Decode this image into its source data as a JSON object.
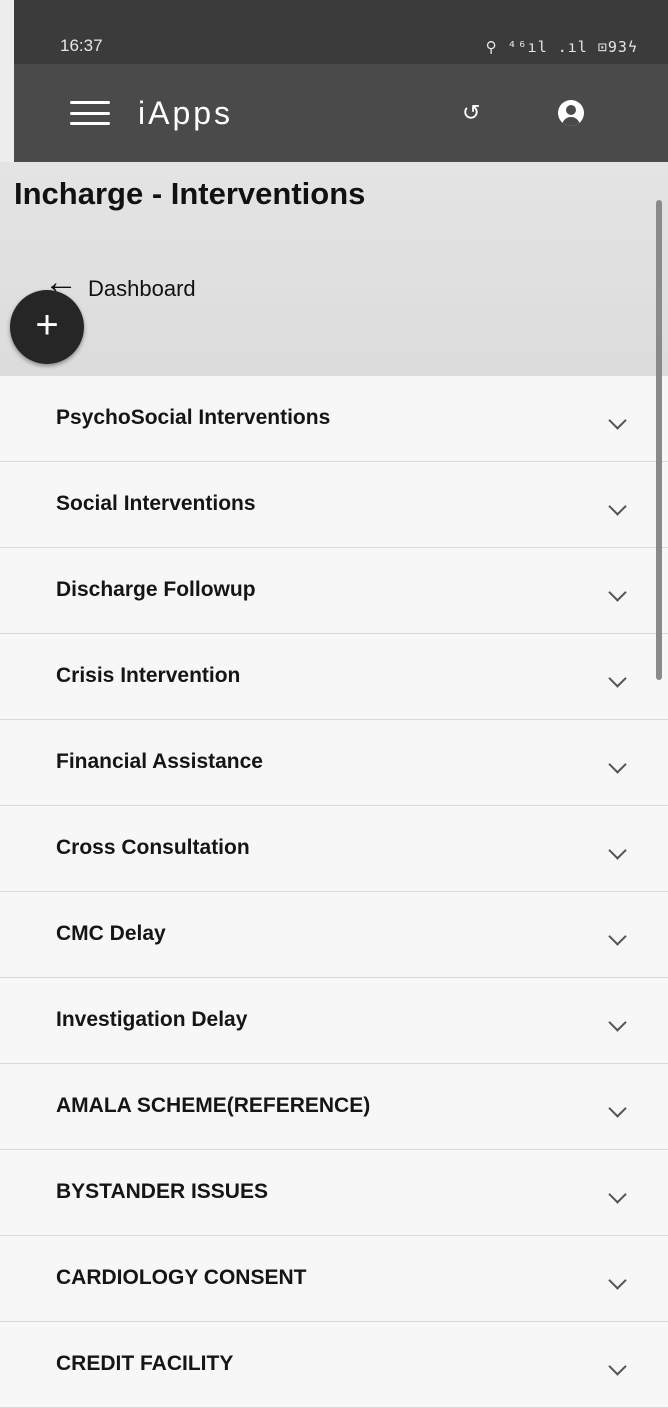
{
  "status_bar": {
    "time": "16:37",
    "indicators": "⚲ ⁴⁶ıl .ıl ⊡93ϟ"
  },
  "app_bar": {
    "title": "iApps"
  },
  "page": {
    "title": "Incharge - Interventions",
    "back_label": "Dashboard",
    "fab_symbol": "+"
  },
  "list": {
    "items": [
      {
        "label": "PsychoSocial Interventions"
      },
      {
        "label": "Social Interventions"
      },
      {
        "label": "Discharge Followup"
      },
      {
        "label": "Crisis Intervention"
      },
      {
        "label": "Financial Assistance"
      },
      {
        "label": "Cross Consultation"
      },
      {
        "label": "CMC Delay"
      },
      {
        "label": "Investigation Delay"
      },
      {
        "label": "AMALA SCHEME(REFERENCE)"
      },
      {
        "label": "BYSTANDER ISSUES"
      },
      {
        "label": "CARDIOLOGY CONSENT"
      },
      {
        "label": "CREDIT FACILITY"
      }
    ]
  }
}
